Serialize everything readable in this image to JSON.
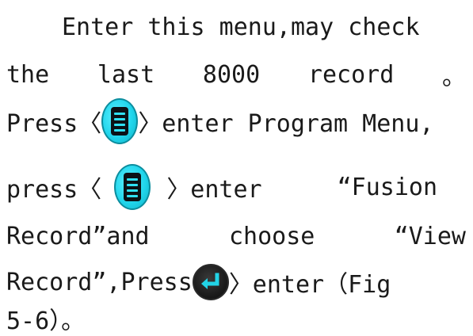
{
  "text": {
    "line1": "Enter this menu,may check",
    "line2": [
      "the",
      "last",
      "8000",
      "record",
      "。"
    ],
    "line3_before": "Press〈",
    "line3_after": "〉enter Program Menu,",
    "line4_before": "press〈",
    "line4_mid": "〉enter",
    "line4_after": "“Fusion",
    "line5": [
      "Record”and",
      "choose",
      "“View"
    ],
    "line6_before": "Record”,Press",
    "line6_after": "〉enter（Fig",
    "line7": "5-6）。"
  },
  "icons": {
    "menu": "menu-key-icon",
    "enter": "enter-key-icon"
  },
  "colors": {
    "menu_key": "#21d6ec",
    "enter_key": "#1c1c1c",
    "enter_arrow": "#22d3e6",
    "text": "#1a1a1a"
  }
}
